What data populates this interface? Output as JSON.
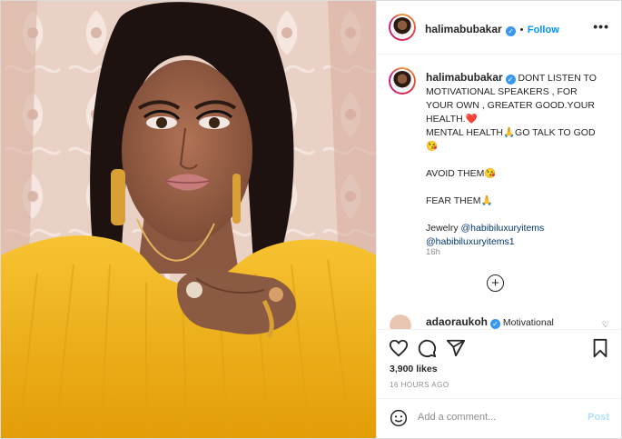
{
  "post": {
    "username": "halimabubakar",
    "verified_icon": "verified-badge-icon",
    "follow_label": "Follow",
    "dot": "•",
    "more_label": "•••"
  },
  "caption": {
    "username": "halimabubakar",
    "lines": [
      "DONT LISTEN TO",
      "MOTIVATIONAL SPEAKERS , FOR",
      "YOUR OWN , GREATER GOOD.YOUR",
      "HEALTH.❤️",
      "MENTAL HEALTH🙏GO TALK TO GOD",
      "😘",
      "AVOID THEM😘",
      "FEAR THEM🙏",
      "Jewelry",
      "@habibiluxuryitems",
      "@habibiluxuryitems1"
    ],
    "time": "16h"
  },
  "comment1": {
    "username": "adaoraukoh",
    "text": "Motivational"
  },
  "actions": {
    "icons": [
      "heart-icon",
      "comment-icon",
      "share-icon",
      "bookmark-icon"
    ]
  },
  "likes": "3,900 likes",
  "posted": "16 HOURS AGO",
  "add_comment": {
    "placeholder": "Add a comment...",
    "post_label": "Post"
  },
  "colors": {
    "accent": "#0095f6",
    "dress": "#f2b21a",
    "wall": "#e4c8bd"
  }
}
